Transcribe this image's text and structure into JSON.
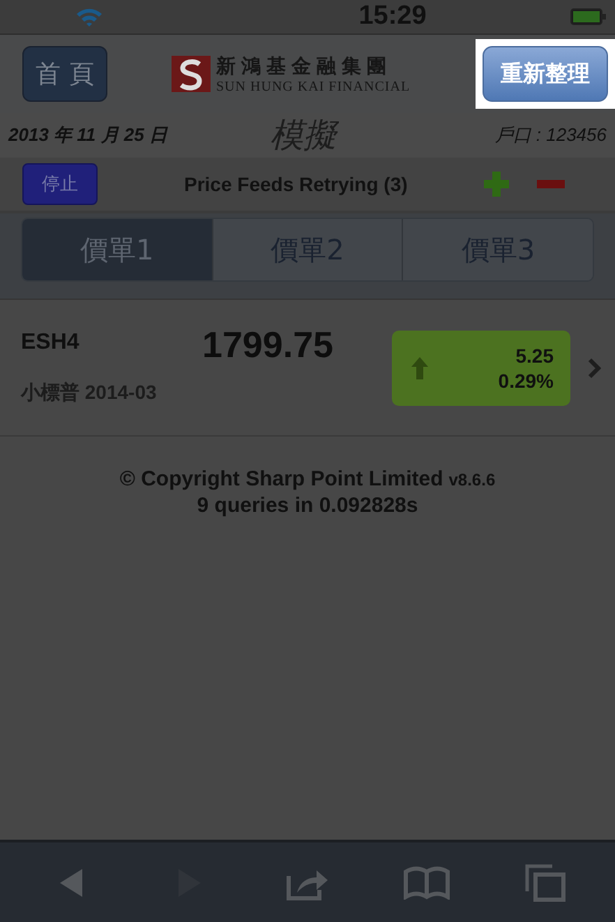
{
  "status_bar": {
    "time": "15:29"
  },
  "header": {
    "home_button": "首 頁",
    "logo_chinese": "新鴻基金融集團",
    "logo_english": "SUN HUNG KAI FINANCIAL",
    "refresh_button": {
      "label": "重新整理",
      "highlighted": true
    }
  },
  "info": {
    "date": "2013 年 11 月 25 日",
    "mode": "模擬",
    "account": "戶口 : 123456"
  },
  "feed": {
    "stop_button": "停止",
    "status": "Price Feeds Retrying (3)"
  },
  "tabs": [
    {
      "label": "價單1",
      "selected": true
    },
    {
      "label": "價單2",
      "selected": false
    },
    {
      "label": "價單3",
      "selected": false
    }
  ],
  "quotes": [
    {
      "symbol": "ESH4",
      "price": "1799.75",
      "name": "小標普 2014-03",
      "change": "5.25",
      "change_pct": "0.29%",
      "rising": true
    }
  ],
  "footer": {
    "copyright": "© Copyright Sharp Point Limited",
    "version": "v8.6.6",
    "queries": "9 queries in 0.092828s"
  },
  "toolbar": [
    {
      "kind": "back",
      "disabled": false
    },
    {
      "kind": "forward",
      "disabled": true
    },
    {
      "kind": "share",
      "disabled": false
    },
    {
      "kind": "bookmarks",
      "disabled": false
    },
    {
      "kind": "pages",
      "disabled": false
    }
  ]
}
